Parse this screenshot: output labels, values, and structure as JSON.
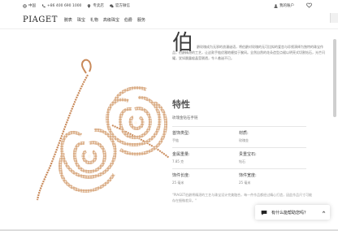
{
  "topbar": {
    "region": "中国",
    "phone": "+86 400 690 1000",
    "stores": "专卖店",
    "wechat": "官方微信",
    "account": "我的账户"
  },
  "nav": {
    "logo": "PIAGET",
    "links": [
      "腕表",
      "珠宝",
      "礼物",
      "高级珠宝",
      "伯爵",
      "服务"
    ]
  },
  "product": {
    "big_char": "伯",
    "description": "爵玫瑰成为无邪的浪漫谜语，将伯爵对玫瑰的无可比拟的爱恋与珍视演绎为独特的珠宝作品；伯爵精湛的工艺，让这款手链优雅地缠绕于腕间。全然自然的花朵造型点缀以明亮式切割钻石，光芒闪耀，犹如晨露般晶莹剔透，令人着迷不已。",
    "spec_title": "特性",
    "spec_subtitle": "玫瑰金钻石手链",
    "specs": [
      {
        "label": "首饰类型:",
        "value": "手链"
      },
      {
        "label": "材质:",
        "value": "玫瑰金"
      },
      {
        "label": "金属重量:",
        "value": "7.85 克"
      },
      {
        "label": "贵重宝石:",
        "value": "钻石"
      },
      {
        "label": "饰件长度:",
        "value": "25 毫米"
      },
      {
        "label": "饰件宽度:",
        "value": "25 毫米"
      }
    ],
    "note": "\"PIAGET伯爵将精湛的工艺与珠宝设计完美融合，每一件作品都经过精心打造，因此作品尺寸可能存在细微差异。\""
  },
  "chat": {
    "label": "有什么能帮助您吗？"
  },
  "colors": {
    "gold": "#c98a5a",
    "text_dark": "#333333",
    "text_muted": "#888888"
  }
}
